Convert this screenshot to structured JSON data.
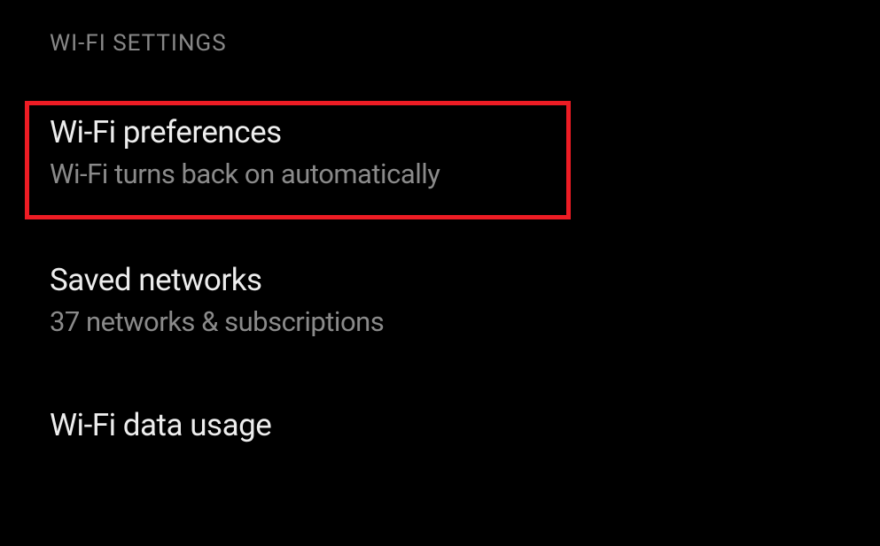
{
  "section": {
    "header": "WI-FI SETTINGS"
  },
  "items": [
    {
      "title": "Wi-Fi preferences",
      "subtitle": "Wi-Fi turns back on automatically"
    },
    {
      "title": "Saved networks",
      "subtitle": "37 networks & subscriptions"
    },
    {
      "title": "Wi-Fi data usage",
      "subtitle": ""
    }
  ],
  "highlight_color": "#ed1c24"
}
